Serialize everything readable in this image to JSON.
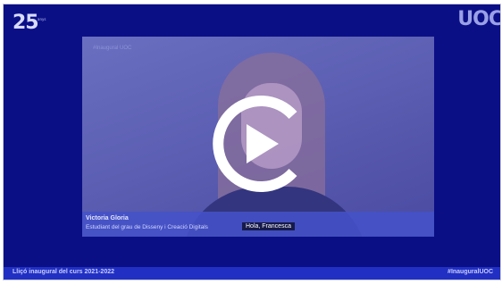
{
  "branding": {
    "anniversary_number": "25",
    "anniversary_caption": "anys",
    "uoc_logo_text": "UOC"
  },
  "video": {
    "overlay_tag": "#Inaugural UOC",
    "speaker_name": "Victoria Gloria",
    "speaker_role": "Estudiant del grau de Disseny i Creació Digitals",
    "subtitle": "Hola, Francesca",
    "play_label": "Play"
  },
  "footer": {
    "event_title": "Lliçó inaugural del curs 2021-2022",
    "hashtag": "#InauguralUOC"
  },
  "colors": {
    "frame_bg": "#0b0f86",
    "footer_bar": "#2130c3",
    "play_icon": "#ffffff"
  }
}
